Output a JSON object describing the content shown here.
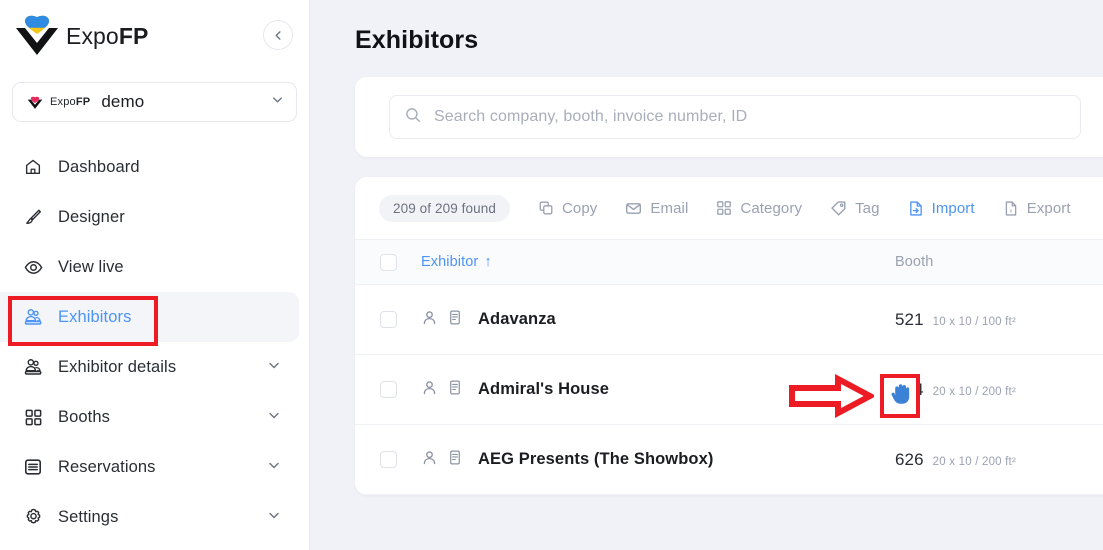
{
  "sidebar": {
    "brand": {
      "name_light": "Expo",
      "name_bold": "FP",
      "logo_icon": "expofp-heart-logo"
    },
    "collapse_icon": "chevron-left-icon",
    "account": {
      "logo_icon": "expofp-heart-small-icon",
      "brand_light": "Expo",
      "brand_bold": "FP",
      "name": "demo",
      "chevron_icon": "chevron-down-icon"
    },
    "items": [
      {
        "label": "Dashboard",
        "icon": "home-icon",
        "active": false,
        "expandable": false
      },
      {
        "label": "Designer",
        "icon": "brush-icon",
        "active": false,
        "expandable": false
      },
      {
        "label": "View live",
        "icon": "eye-icon",
        "active": false,
        "expandable": false
      },
      {
        "label": "Exhibitors",
        "icon": "exhibitors-icon",
        "active": true,
        "expandable": false
      },
      {
        "label": "Exhibitor details",
        "icon": "exhibitors-icon",
        "active": false,
        "expandable": true
      },
      {
        "label": "Booths",
        "icon": "grid-icon",
        "active": false,
        "expandable": true
      },
      {
        "label": "Reservations",
        "icon": "list-card-icon",
        "active": false,
        "expandable": true
      },
      {
        "label": "Settings",
        "icon": "gear-icon",
        "active": false,
        "expandable": true
      }
    ]
  },
  "main": {
    "page_title": "Exhibitors",
    "search": {
      "icon": "search-icon",
      "value": "",
      "placeholder": "Search company, booth, invoice number, ID"
    },
    "toolbar": {
      "count_label": "209 of 209 found",
      "buttons": [
        {
          "label": "Copy",
          "icon": "copy-icon",
          "accent": false
        },
        {
          "label": "Email",
          "icon": "envelope-icon",
          "accent": false
        },
        {
          "label": "Category",
          "icon": "grid-icon",
          "accent": false
        },
        {
          "label": "Tag",
          "icon": "tag-icon",
          "accent": false
        },
        {
          "label": "Import",
          "icon": "import-icon",
          "accent": true
        },
        {
          "label": "Export",
          "icon": "export-icon",
          "accent": false
        }
      ]
    },
    "table": {
      "header": {
        "select_all_icon": "checkbox-icon",
        "exhibitor": "Exhibitor",
        "sort_indicator": "↑",
        "booth": "Booth"
      },
      "rows": [
        {
          "name": "Adavanza",
          "booth": "521",
          "dimensions": "10 x 10 / 100 ft²",
          "person_icon": "person-icon",
          "details_icon": "document-icon"
        },
        {
          "name": "Admiral's House",
          "booth": "344",
          "dimensions": "20 x 10 / 200 ft²",
          "person_icon": "person-icon",
          "details_icon": "document-icon"
        },
        {
          "name": "AEG Presents (The Showbox)",
          "booth": "626",
          "dimensions": "20 x 10 / 200 ft²",
          "person_icon": "person-icon",
          "details_icon": "document-icon"
        }
      ]
    }
  },
  "annotations": {
    "highlight_color": "#ed1c24",
    "nav_highlight_target": "Exhibitors",
    "arrow_icon": "red-right-arrow-annotation",
    "cursor_icon": "blue-hand-cursor",
    "cursor_color": "#3b82d6"
  }
}
